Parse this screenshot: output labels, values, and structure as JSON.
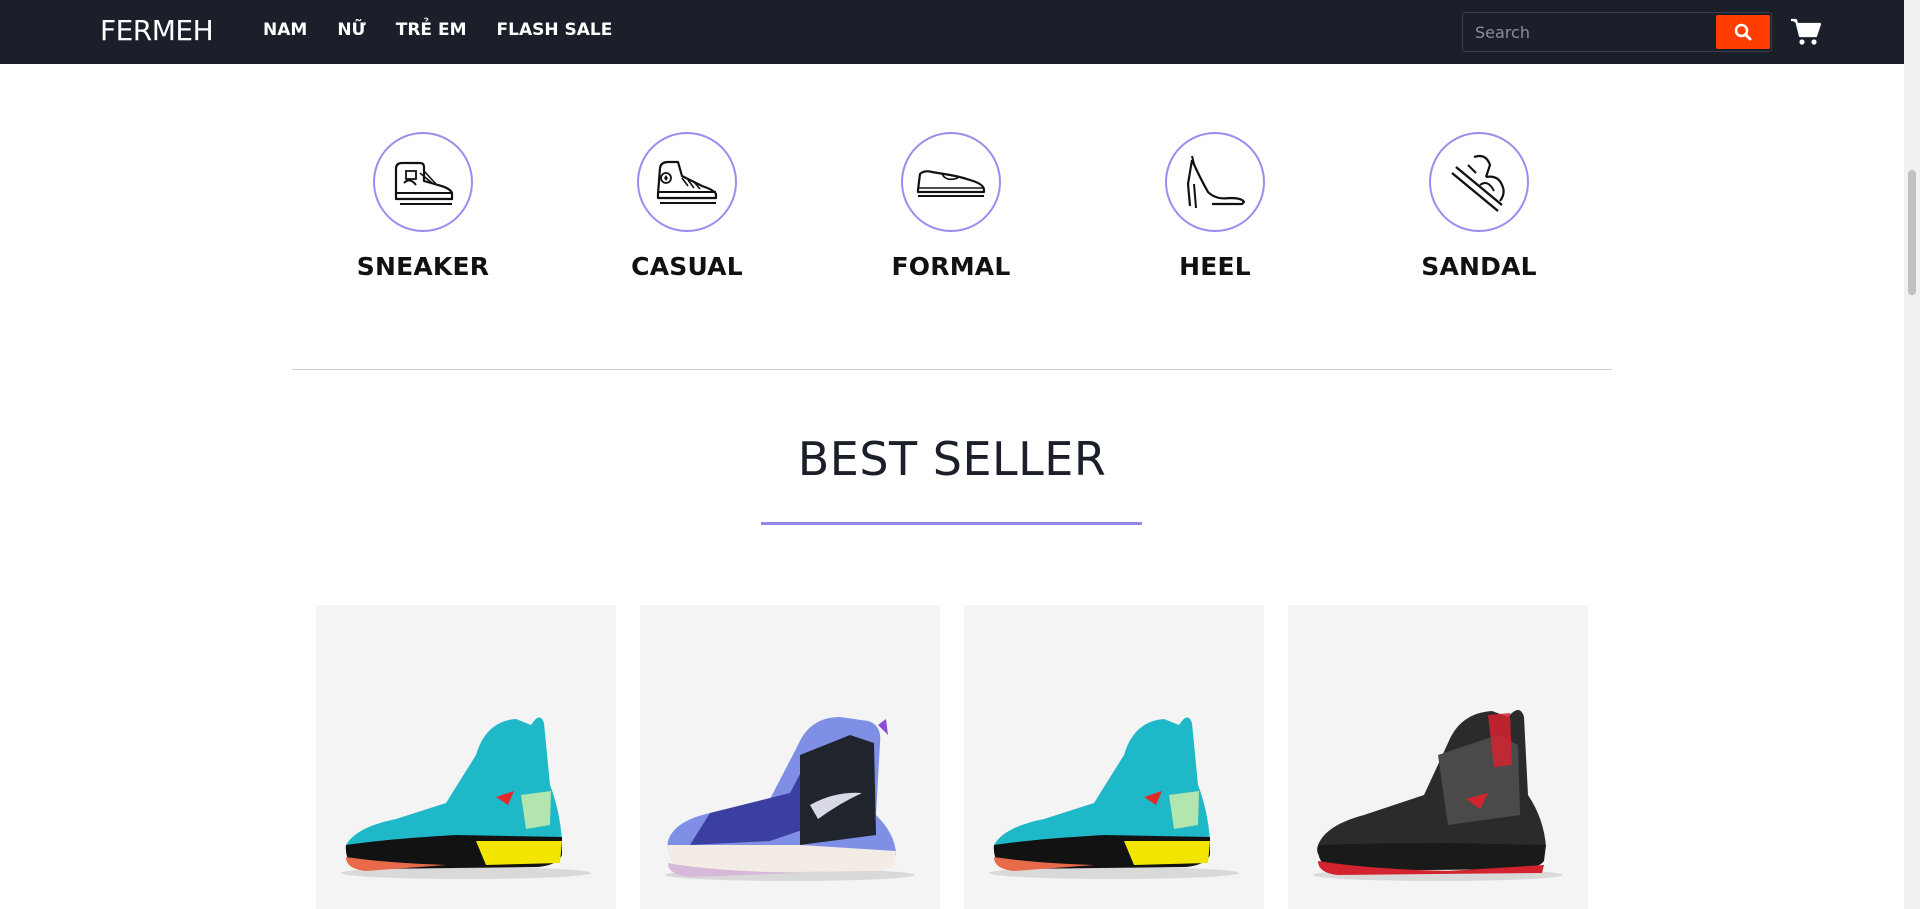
{
  "header": {
    "brand": "FERMEH",
    "nav": [
      "NAM",
      "NỮ",
      "TRẺ EM",
      "FLASH SALE"
    ],
    "search_placeholder": "Search",
    "search_icon": "search-icon",
    "cart_icon": "cart-icon"
  },
  "categories": [
    {
      "label": "SNEAKER",
      "icon": "sneaker-icon"
    },
    {
      "label": "CASUAL",
      "icon": "casual-shoe-icon"
    },
    {
      "label": "FORMAL",
      "icon": "formal-shoe-icon"
    },
    {
      "label": "HEEL",
      "icon": "heel-icon"
    },
    {
      "label": "SANDAL",
      "icon": "sandal-icon"
    }
  ],
  "best_seller": {
    "title": "BEST SELLER",
    "products": [
      {
        "name": "teal-basketball-shoe",
        "colors": [
          "#1fb8c9",
          "#f2e600",
          "#e86a4a"
        ]
      },
      {
        "name": "purple-camo-basketball-shoe",
        "colors": [
          "#7f8fe6",
          "#20242c",
          "#e8d9e8"
        ]
      },
      {
        "name": "teal-basketball-shoe",
        "colors": [
          "#1fb8c9",
          "#f2e600",
          "#e86a4a"
        ]
      },
      {
        "name": "black-red-basketball-shoe",
        "colors": [
          "#2b2b2b",
          "#d3232f",
          "#4a4a4a"
        ]
      }
    ]
  },
  "colors": {
    "header_bg": "#1b1f2a",
    "accent": "#ff3d00",
    "circle_border": "#9b8cf0",
    "title_underline": "#8f88e6"
  }
}
